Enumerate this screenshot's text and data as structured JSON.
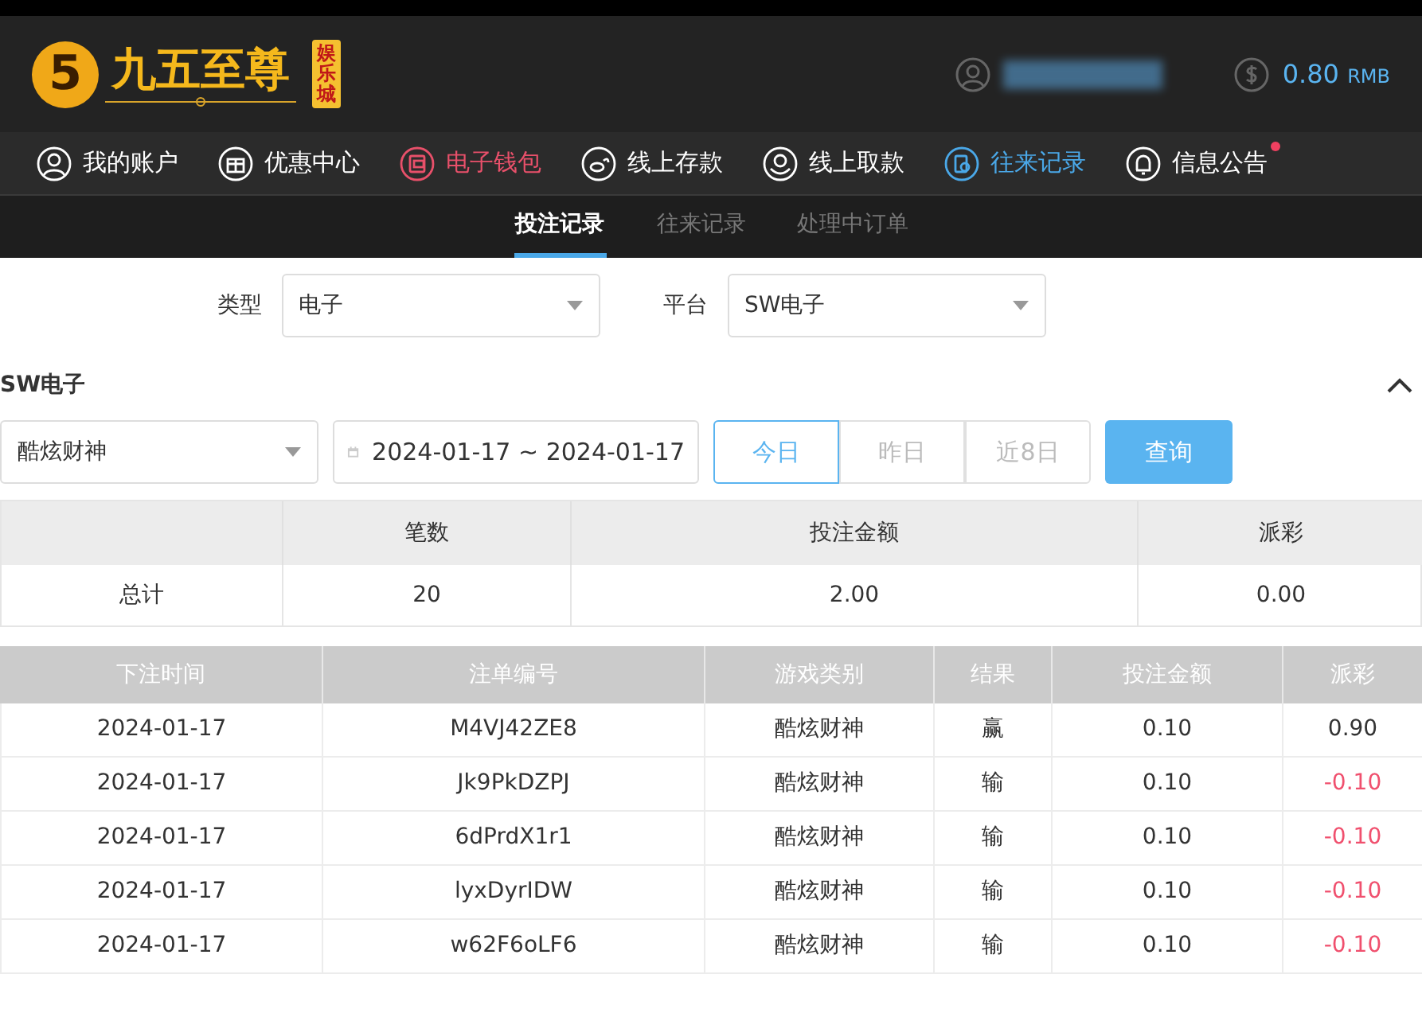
{
  "header": {
    "logo": {
      "mark": "5",
      "name": "九五至尊",
      "badge": "娱乐城"
    },
    "balance": {
      "amount": "0.80",
      "currency": "RMB"
    }
  },
  "nav": [
    {
      "label": "我的账户",
      "color": "#ffffff",
      "dot": false
    },
    {
      "label": "优惠中心",
      "color": "#ffffff",
      "dot": false
    },
    {
      "label": "电子钱包",
      "color": "#e8506a",
      "dot": false
    },
    {
      "label": "线上存款",
      "color": "#ffffff",
      "dot": false
    },
    {
      "label": "线上取款",
      "color": "#ffffff",
      "dot": false
    },
    {
      "label": "往来记录",
      "color": "#4aa8e8",
      "dot": false
    },
    {
      "label": "信息公告",
      "color": "#ffffff",
      "dot": true
    }
  ],
  "subtabs": [
    {
      "label": "投注记录",
      "selected": true
    },
    {
      "label": "往来记录",
      "selected": false
    },
    {
      "label": "处理中订单",
      "selected": false
    }
  ],
  "filters": [
    {
      "label": "类型",
      "value": "电子"
    },
    {
      "label": "平台",
      "value": "SW电子"
    }
  ],
  "section": {
    "title": "SW电子",
    "expanded": true
  },
  "game_select": {
    "value": "酷炫财神"
  },
  "date_range": {
    "value": "2024-01-17 ~ 2024-01-17"
  },
  "quick_ranges": [
    {
      "label": "今日",
      "selected": true
    },
    {
      "label": "昨日",
      "selected": false
    },
    {
      "label": "近8日",
      "selected": false
    }
  ],
  "query_button": "查询",
  "summary": {
    "columns": [
      "笔数",
      "投注金额",
      "派彩"
    ],
    "row": {
      "label": "总计",
      "values": [
        "20",
        "2.00",
        "0.00"
      ]
    }
  },
  "table": {
    "columns": [
      "下注时间",
      "注单编号",
      "游戏类别",
      "结果",
      "投注金额",
      "派彩"
    ],
    "rows": [
      {
        "cells": [
          "2024-01-17",
          "M4VJ42ZE8",
          "酷炫财神",
          "赢",
          "0.10",
          "0.90"
        ],
        "negative": false
      },
      {
        "cells": [
          "2024-01-17",
          "Jk9PkDZPJ",
          "酷炫财神",
          "输",
          "0.10",
          "-0.10"
        ],
        "negative": true
      },
      {
        "cells": [
          "2024-01-17",
          "6dPrdX1r1",
          "酷炫财神",
          "输",
          "0.10",
          "-0.10"
        ],
        "negative": true
      },
      {
        "cells": [
          "2024-01-17",
          "lyxDyrIDW",
          "酷炫财神",
          "输",
          "0.10",
          "-0.10"
        ],
        "negative": true
      },
      {
        "cells": [
          "2024-01-17",
          "w62F6oLF6",
          "酷炫财神",
          "输",
          "0.10",
          "-0.10"
        ],
        "negative": true
      }
    ]
  }
}
